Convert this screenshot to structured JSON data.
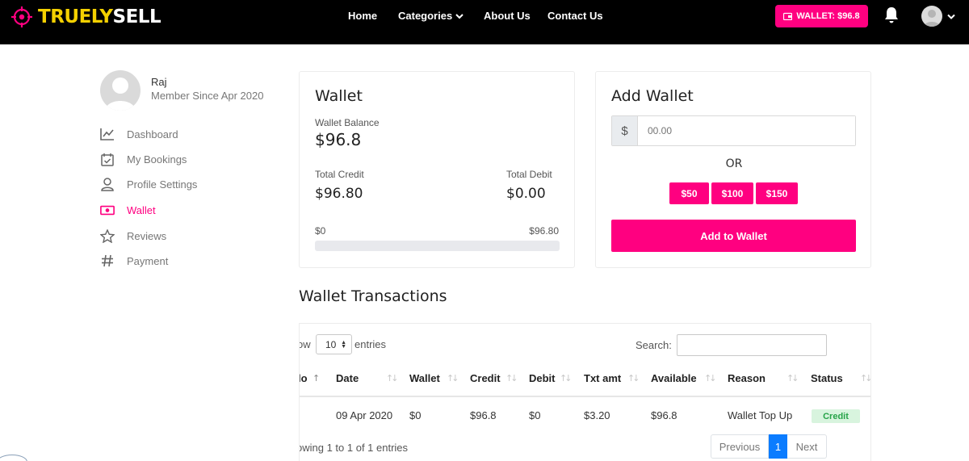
{
  "header": {
    "logo": {
      "part1": "TRUELY",
      "part2": "SELL"
    },
    "nav": {
      "home": "Home",
      "categories": "Categories",
      "about": "About Us",
      "contact": "Contact Us"
    },
    "wallet_button": "WALLET: $96.8"
  },
  "sidebar": {
    "user_name": "Raj",
    "member_since": "Member Since Apr 2020",
    "items": [
      {
        "label": "Dashboard",
        "icon": "chart-line-icon"
      },
      {
        "label": "My Bookings",
        "icon": "calendar-check-icon"
      },
      {
        "label": "Profile Settings",
        "icon": "user-icon"
      },
      {
        "label": "Wallet",
        "icon": "money-bill-icon",
        "active": true
      },
      {
        "label": "Reviews",
        "icon": "star-icon"
      },
      {
        "label": "Payment",
        "icon": "hashtag-icon"
      }
    ]
  },
  "wallet": {
    "title": "Wallet",
    "balance_label": "Wallet Balance",
    "balance": "$96.8",
    "credit_label": "Total Credit",
    "credit": "$96.80",
    "debit_label": "Total Debit",
    "debit": "$0.00",
    "range_min": "$0",
    "range_max": "$96.80",
    "progress_fraction": 1.0
  },
  "add_wallet": {
    "title": "Add Wallet",
    "currency": "$",
    "amount_placeholder": "00.00",
    "or": "OR",
    "quick_amounts": [
      "$50",
      "$100",
      "$150"
    ],
    "submit": "Add to Wallet"
  },
  "transactions": {
    "title": "Wallet Transactions",
    "show_prefix": "ow",
    "page_length": "10",
    "entries_suffix": "entries",
    "search_label": "Search:",
    "columns": [
      "lo",
      "Date",
      "Wallet",
      "Credit",
      "Debit",
      "Txt amt",
      "Available",
      "Reason",
      "Status"
    ],
    "rows": [
      {
        "date": "09 Apr 2020",
        "wallet": "$0",
        "credit": "$96.8",
        "debit": "$0",
        "txt_amt": "$3.20",
        "available": "$96.8",
        "reason": "Wallet Top Up",
        "status": "Credit"
      }
    ],
    "info": "owing 1 to 1 of 1 entries",
    "pagination": {
      "previous": "Previous",
      "current": "1",
      "next": "Next"
    }
  },
  "colors": {
    "accent": "#ff0080",
    "header_bg": "#000000",
    "logo_yellow": "#f4d000",
    "status_green": "#26a348",
    "page_blue": "#0b7cff"
  }
}
